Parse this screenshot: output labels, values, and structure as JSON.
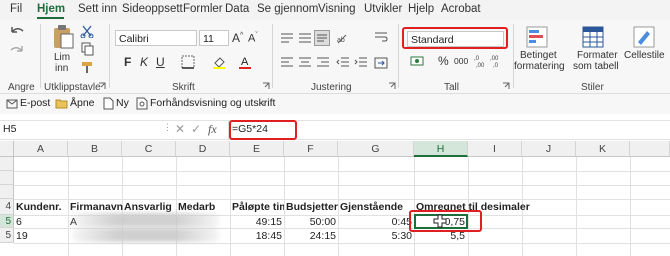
{
  "tabs": [
    "Fil",
    "Hjem",
    "Sett inn",
    "Sideoppsett",
    "Formler",
    "Data",
    "Se gjennom",
    "Visning",
    "Utvikler",
    "Hjelp",
    "Acrobat"
  ],
  "active_tab": "Hjem",
  "ribbon": {
    "clipboard": {
      "paste_label": "Lim",
      "paste_label2": "inn",
      "group_label": "Utklippstavle"
    },
    "undo_group_label": "Angre",
    "font": {
      "name": "Calibri",
      "size": "11",
      "group_label": "Skrift",
      "bold": "F",
      "italic": "K",
      "underline": "U"
    },
    "alignment_group_label": "Justering",
    "number": {
      "format": "Standard",
      "group_label": "Tall",
      "percent": "%",
      "comma": "000"
    },
    "styles": {
      "conditional_label": "Betinget",
      "conditional_label2": "formatering",
      "table_label": "Formater",
      "table_label2": "som tabell",
      "cellstyles_label": "Cellestile",
      "group_label": "Stiler"
    }
  },
  "qat": {
    "email": "E-post",
    "open": "Åpne",
    "new": "Ny",
    "preview": "Forhåndsvisning og utskrift"
  },
  "formula_bar": {
    "name_box": "H5",
    "fx": "fx",
    "formula": "=G5*24"
  },
  "columns": [
    "A",
    "B",
    "C",
    "D",
    "E",
    "F",
    "G",
    "H",
    "I",
    "J",
    "K"
  ],
  "selected_column": "H",
  "rows": [
    "",
    "",
    "",
    "4",
    "5",
    "5"
  ],
  "headers_row": {
    "A": "Kundenr.",
    "B": "Firmanavn",
    "C": "Ansvarlig",
    "D": "Medarb",
    "E": "Påløpte time",
    "F": "Budsjetterte",
    "G": "Gjenstående",
    "H": "Omregnet til desimaler"
  },
  "data_rows": [
    {
      "A": "6",
      "B": "A",
      "E": "49:15",
      "F": "50:00",
      "G": "0:45",
      "H": "0,75"
    },
    {
      "A": "19",
      "B": "",
      "E": "18:45",
      "F": "24:15",
      "G": "5:30",
      "H": "5,5"
    }
  ],
  "colors": {
    "accent": "#1e6e3c",
    "highlight": "#e02020"
  }
}
